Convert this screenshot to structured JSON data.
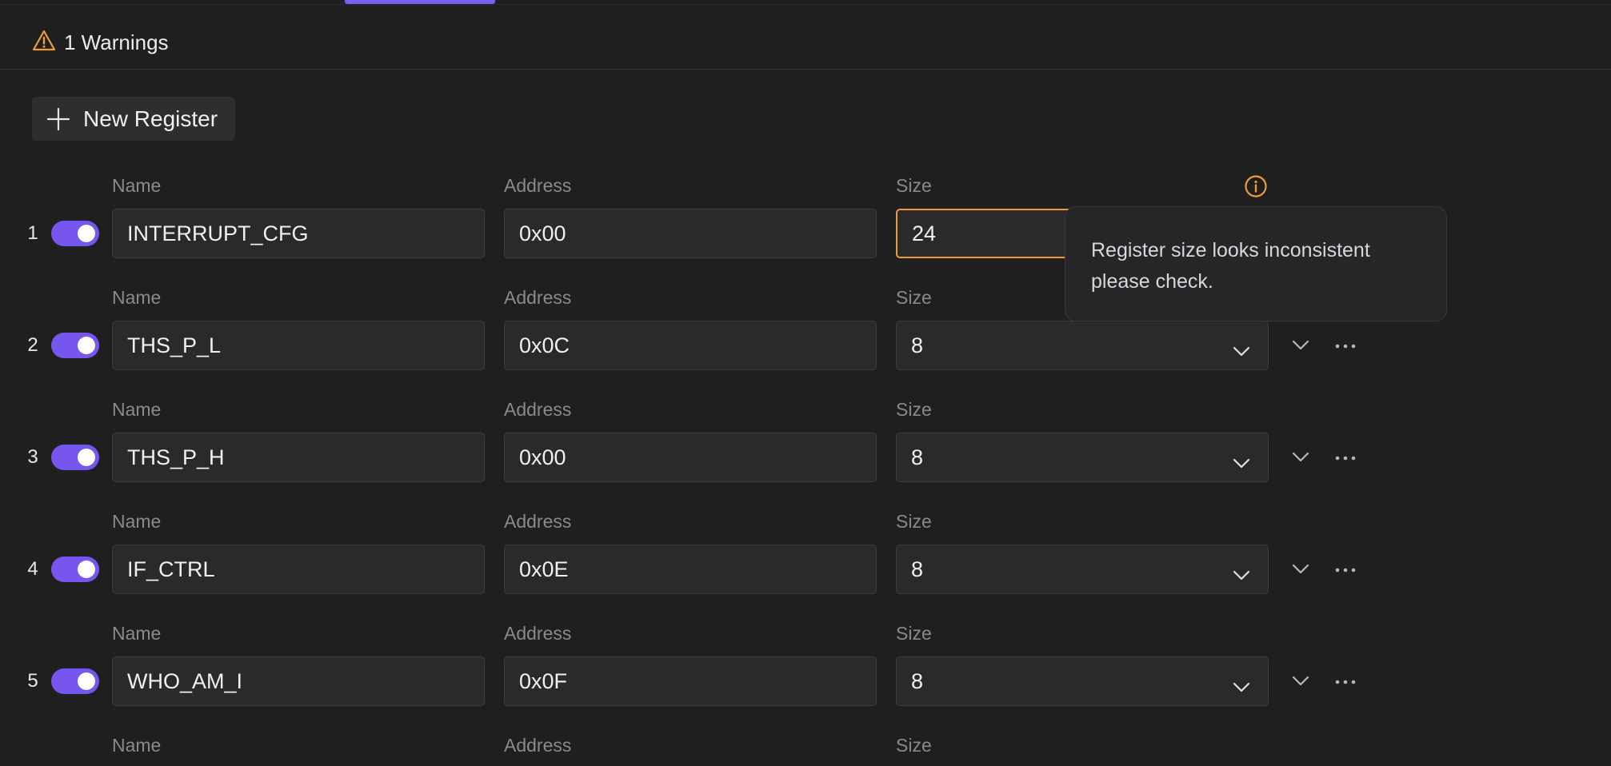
{
  "warnings": {
    "label": "1 Warnings"
  },
  "toolbar": {
    "new_register_label": "New Register"
  },
  "field_labels": {
    "name": "Name",
    "address": "Address",
    "size": "Size"
  },
  "tooltip": {
    "line1": "Register size looks inconsistent",
    "line2": "please check."
  },
  "registers": [
    {
      "index": "1",
      "enabled": true,
      "name": "INTERRUPT_CFG",
      "address": "0x00",
      "size": "24",
      "warning": true
    },
    {
      "index": "2",
      "enabled": true,
      "name": "THS_P_L",
      "address": "0x0C",
      "size": "8"
    },
    {
      "index": "3",
      "enabled": true,
      "name": "THS_P_H",
      "address": "0x00",
      "size": "8"
    },
    {
      "index": "4",
      "enabled": true,
      "name": "IF_CTRL",
      "address": "0x0E",
      "size": "8"
    },
    {
      "index": "5",
      "enabled": true,
      "name": "WHO_AM_I",
      "address": "0x0F",
      "size": "8"
    }
  ],
  "colors": {
    "accent": "#7656ee",
    "warning": "#ef9a3d",
    "background": "#1f1f20"
  },
  "icons": {
    "warning": "warning-triangle-icon",
    "add": "plus-icon",
    "info": "info-icon",
    "dropdown": "chevron-down-icon",
    "more": "more-horizontal-icon"
  }
}
